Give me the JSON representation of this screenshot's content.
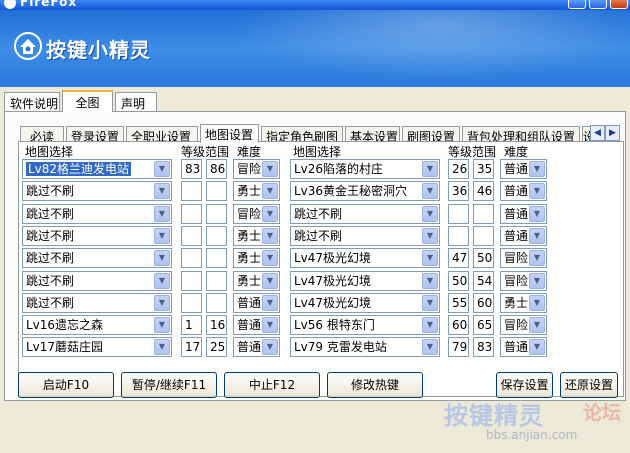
{
  "window": {
    "title": "FireFox"
  },
  "banner": {
    "brand": "按键小精灵"
  },
  "outer_tabs": [
    "软件说明",
    "全图",
    "声明"
  ],
  "inner_tabs": [
    "必读",
    "登录设置",
    "全职业设置",
    "地图设置",
    "指定角色刷图",
    "基本设置",
    "刷图设置",
    "背包处理和组队设置",
    "设"
  ],
  "tab_scroll": {
    "left": "◀",
    "right": "▶"
  },
  "headers": {
    "map": "地图选择",
    "range": "等级范围",
    "difficulty": "难度"
  },
  "left_rows": [
    {
      "map": "Lv82格兰迪发电站",
      "min": "83",
      "max": "86",
      "diff": "冒险"
    },
    {
      "map": "跳过不刷",
      "min": "",
      "max": "",
      "diff": "勇士"
    },
    {
      "map": "跳过不刷",
      "min": "",
      "max": "",
      "diff": "冒险"
    },
    {
      "map": "跳过不刷",
      "min": "",
      "max": "",
      "diff": "勇士"
    },
    {
      "map": "跳过不刷",
      "min": "",
      "max": "",
      "diff": "勇士"
    },
    {
      "map": "跳过不刷",
      "min": "",
      "max": "",
      "diff": "勇士"
    },
    {
      "map": "跳过不刷",
      "min": "",
      "max": "",
      "diff": "普通"
    },
    {
      "map": "Lv16遗忘之森",
      "min": "1",
      "max": "16",
      "diff": "普通"
    },
    {
      "map": "Lv17蘑菇庄园",
      "min": "17",
      "max": "25",
      "diff": "普通"
    }
  ],
  "right_rows": [
    {
      "map": "Lv26陷落的村庄",
      "min": "26",
      "max": "35",
      "diff": "普通"
    },
    {
      "map": "Lv36黄金王秘密洞穴",
      "min": "36",
      "max": "46",
      "diff": "普通"
    },
    {
      "map": "跳过不刷",
      "min": "",
      "max": "",
      "diff": "普通"
    },
    {
      "map": "跳过不刷",
      "min": "",
      "max": "",
      "diff": "普通"
    },
    {
      "map": "Lv47极光幻境",
      "min": "47",
      "max": "50",
      "diff": "冒险"
    },
    {
      "map": "Lv47极光幻境",
      "min": "50",
      "max": "54",
      "diff": "冒险"
    },
    {
      "map": "Lv47极光幻境",
      "min": "55",
      "max": "60",
      "diff": "勇士"
    },
    {
      "map": "Lv56 根特东门",
      "min": "60",
      "max": "65",
      "diff": "冒险"
    },
    {
      "map": "Lv79 克雷发电站",
      "min": "79",
      "max": "83",
      "diff": "普通"
    }
  ],
  "buttons": {
    "start": "启动F10",
    "pause": "暂停/继续F11",
    "stop": "中止F12",
    "hotkey": "修改热键",
    "save": "保存设置",
    "restore": "还原设置"
  },
  "watermark": {
    "big": "按键精灵",
    "lt": "论坛",
    "url": "bbs.anjian.com"
  },
  "dropdown_glyph": "▼",
  "colors": {
    "banner": "#2a78dc",
    "selection": "#316ac5",
    "active_tab_accent": "#f7b33a"
  }
}
